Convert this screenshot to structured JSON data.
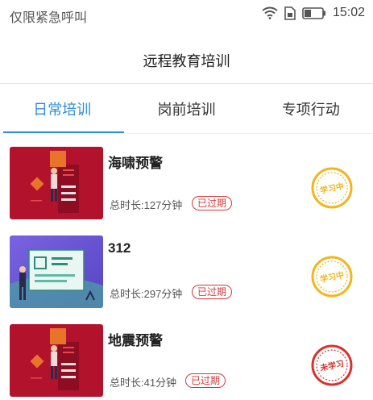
{
  "status_bar": {
    "carrier_text": "仅限紧急呼叫",
    "time": "15:02",
    "icons": [
      "wifi-icon",
      "sim-icon",
      "battery-icon"
    ]
  },
  "header": {
    "title": "远程教育培训"
  },
  "tabs": [
    {
      "label": "日常培训",
      "active": true
    },
    {
      "label": "岗前培训",
      "active": false
    },
    {
      "label": "专项行动",
      "active": false
    }
  ],
  "courses": [
    {
      "title": "海啸预警",
      "duration": "总时长:127分钟",
      "badge": "已过期",
      "stamp": "学习中",
      "stamp_color": "#f2b51b",
      "thumb": "red-presenter"
    },
    {
      "title": "312",
      "duration": "总时长:297分钟",
      "badge": "已过期",
      "stamp": "学习中",
      "stamp_color": "#f2b51b",
      "thumb": "purple-board"
    },
    {
      "title": "地震预警",
      "duration": "总时长:41分钟",
      "badge": "已过期",
      "stamp": "未学习",
      "stamp_color": "#d8322f",
      "thumb": "red-presenter"
    }
  ],
  "colors": {
    "accent": "#2e8ed8",
    "expired": "#d33a3a",
    "thumb_red": "#b3122c",
    "thumb_purple": "#6a58d6"
  }
}
